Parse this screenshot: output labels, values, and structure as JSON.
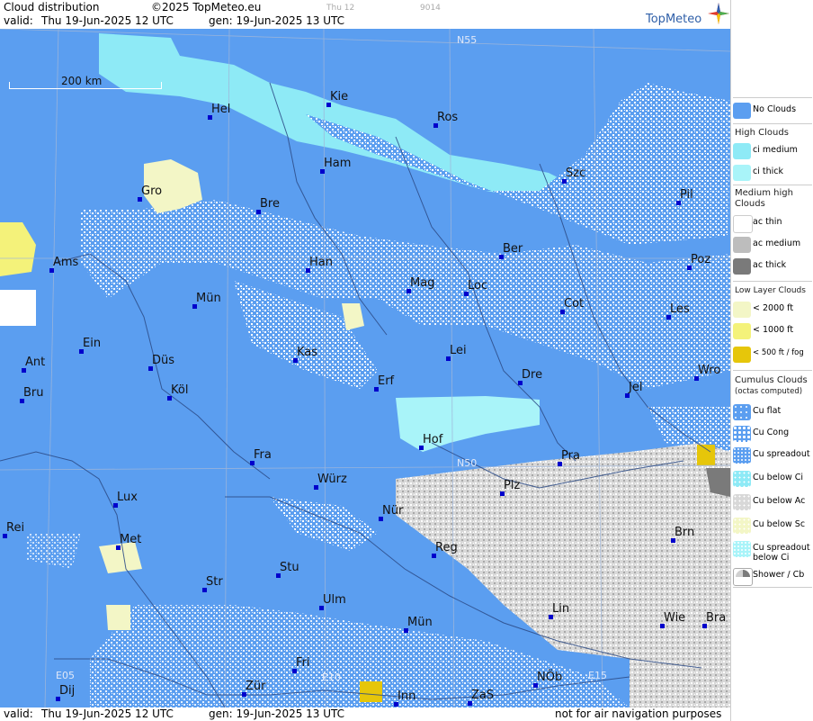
{
  "header": {
    "title": "Cloud distribution",
    "copyright": "©2025 TopMeteo.eu",
    "valid_label": "valid:",
    "valid_value": "Thu  19-Jun-2025  12 UTC",
    "gen_label": "gen: 19-Jun-2025 13 UTC",
    "tab_day": "Thu 12",
    "tab_code": "9014",
    "logo": "TopMeteo"
  },
  "footer": {
    "valid_label": "valid:",
    "valid_value": "Thu  19-Jun-2025  12 UTC",
    "gen_label": "gen: 19-Jun-2025 13 UTC",
    "disclaimer": "not for air navigation purposes"
  },
  "map": {
    "scale_label": "200 km",
    "grid_labels": [
      "N55",
      "N50",
      "E05",
      "E10",
      "E15"
    ],
    "cities": [
      "Hel",
      "Kie",
      "Ros",
      "Ham",
      "Szc",
      "Gro",
      "Bre",
      "Pil",
      "Ams",
      "Han",
      "Ber",
      "Poz",
      "Mag",
      "Loc",
      "Mün",
      "Cot",
      "Les",
      "Ein",
      "Kas",
      "Lei",
      "Ant",
      "Düs",
      "Dre",
      "Wro",
      "Bru",
      "Köl",
      "Erf",
      "Jel",
      "Hof",
      "Pra",
      "Fra",
      "Würz",
      "Plz",
      "Lux",
      "Rei",
      "Nür",
      "Brn",
      "Met",
      "Reg",
      "Stu",
      "Str",
      "Lin",
      "Ulm",
      "Wie",
      "Bra",
      "Mün",
      "Fri",
      "Zür",
      "Dij",
      "Inn",
      "ZaS",
      "NÖb"
    ]
  },
  "legend": {
    "no_clouds": "No Clouds",
    "high_clouds": "High Clouds",
    "ci_medium": "ci medium",
    "ci_thick": "ci thick",
    "medium_high": "Medium high Clouds",
    "ac_thin": "ac thin",
    "ac_medium": "ac medium",
    "ac_thick": "ac thick",
    "low_layer": "Low Layer Clouds",
    "lt2000": "< 2000 ft",
    "lt1000": "< 1000 ft",
    "lt500": "< 500 ft / fog",
    "cumulus": "Cumulus Clouds",
    "cumulus_sub": "(octas computed)",
    "cu_flat": "Cu flat",
    "cu_cong": "Cu Cong",
    "cu_spread": "Cu spreadout",
    "cu_below_ci": "Cu below Ci",
    "cu_below_ac": "Cu below Ac",
    "cu_below_sc": "Cu below Sc",
    "cu_spread_below_ci": "Cu spreadout below Ci",
    "shower": "Shower / Cb"
  },
  "colors": {
    "no_clouds": "#5b9ef0",
    "ci_medium": "#8eeaf6",
    "ci_thick": "#a9f4f9",
    "ac_thin": "#ffffff",
    "ac_medium": "#bdbdbd",
    "ac_thick": "#7a7a7a",
    "low_2000": "#f3f6c6",
    "low_1000": "#f4f27a",
    "low_500": "#e6c60a"
  }
}
